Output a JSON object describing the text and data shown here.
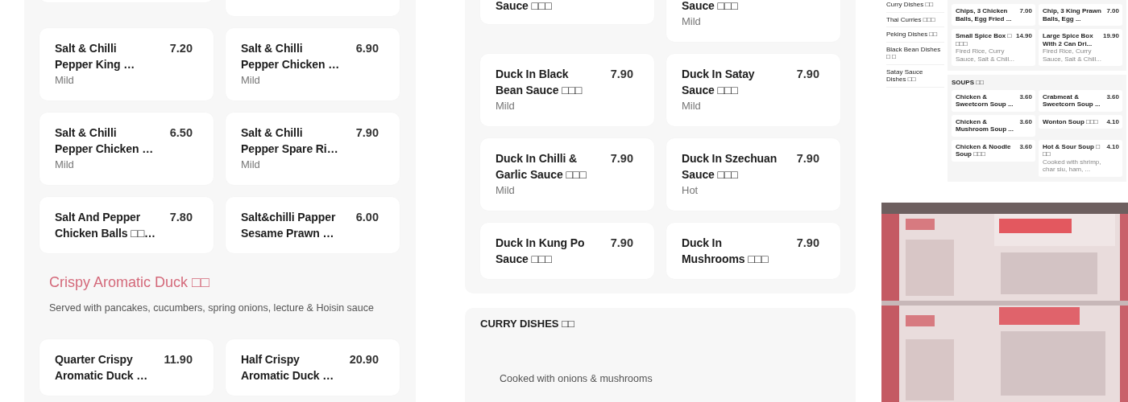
{
  "left_panel": {
    "items": [
      {
        "kind": "clipped"
      },
      {
        "kind": "clipped"
      },
      {
        "name": "Salt & Chilli Pepper King …",
        "price": "7.20",
        "spice": "Mild"
      },
      {
        "name": "Salt & Chilli Pepper Chicken …",
        "price": "6.90",
        "spice": "Mild"
      },
      {
        "name": "Salt & Chilli Pepper Chicken …",
        "price": "6.50",
        "spice": "Mild"
      },
      {
        "name": "Salt & Chilli Pepper Spare Ri…",
        "price": "7.90",
        "spice": "Mild"
      },
      {
        "name": "Salt And Pepper Chicken Balls □□…",
        "price": "7.80"
      },
      {
        "name": "Salt&chilli Papper Sesame Prawn …",
        "price": "6.00"
      }
    ],
    "section": {
      "title": "Crispy Aromatic Duck □□",
      "description": "Served with pancakes, cucumbers, spring onions, lecture & Hoisin sauce",
      "items": [
        {
          "name": "Quarter Crispy Aromatic Duck …",
          "price": "11.90"
        },
        {
          "name": "Half Crispy Aromatic Duck …",
          "price": "20.90"
        }
      ]
    }
  },
  "middle_panel": {
    "items": [
      {
        "clipped": true,
        "name": "Sauce □□□"
      },
      {
        "clipped": true,
        "name": "Sauce □□□",
        "spice": "Mild"
      },
      {
        "name": "Duck In Black Bean Sauce □□□",
        "price": "7.90",
        "spice": "Mild"
      },
      {
        "name": "Duck In Satay Sauce □□□",
        "price": "7.90",
        "spice": "Mild"
      },
      {
        "name": "Duck In Chilli & Garlic Sauce □□□",
        "price": "7.90",
        "spice": "Mild"
      },
      {
        "name": "Duck In Szechuan Sauce □□□",
        "price": "7.90",
        "spice": "Hot"
      },
      {
        "name": "Duck In Kung Po Sauce □□□",
        "price": "7.90"
      },
      {
        "name": "Duck In Mushrooms □□□",
        "price": "7.90"
      }
    ]
  },
  "curry_section": {
    "title": "CURRY DISHES □□",
    "description": "Cooked with onions & mushrooms"
  },
  "thumbnail": {
    "sidebar": [
      "Curry Dishes □□",
      "Thai Curries □□□",
      "Peking Dishes □□",
      "Black Bean Dishes □ □",
      "Satay Sauce Dishes □□"
    ],
    "sections": [
      {
        "items": [
          {
            "name": "Chips, 3 Chicken Balls, Egg Fried ...",
            "price": "7.00"
          },
          {
            "name": "Chip, 3 King Prawn Balls, Egg ...",
            "price": "7.00"
          },
          {
            "name": "Small Spice Box □ □□□",
            "price": "14.90",
            "description": "Fired Rice, Curry Sauce, Salt & Chill..."
          },
          {
            "name": "Large Spice Box With 2 Can Dri...",
            "price": "19.90",
            "description": "Fired Rice, Curry Sauce, Salt & Chill..."
          }
        ]
      },
      {
        "title": "SOUPS □□",
        "items": [
          {
            "name": "Chicken & Sweetcorn Soup ...",
            "price": "3.60"
          },
          {
            "name": "Crabmeat & Sweetcorn Soup ...",
            "price": "3.60"
          },
          {
            "name": "Chicken & Mushroom Soup ...",
            "price": "3.60"
          },
          {
            "name": "Wonton Soup □□□",
            "price": "4.10"
          },
          {
            "name": "Chicken & Noodle Soup □□□",
            "price": "3.60"
          },
          {
            "name": "Hot & Sour Soup □ □□",
            "price": "4.10",
            "description": "Cooked with shrimp, char siu, ham, ..."
          }
        ]
      }
    ]
  }
}
